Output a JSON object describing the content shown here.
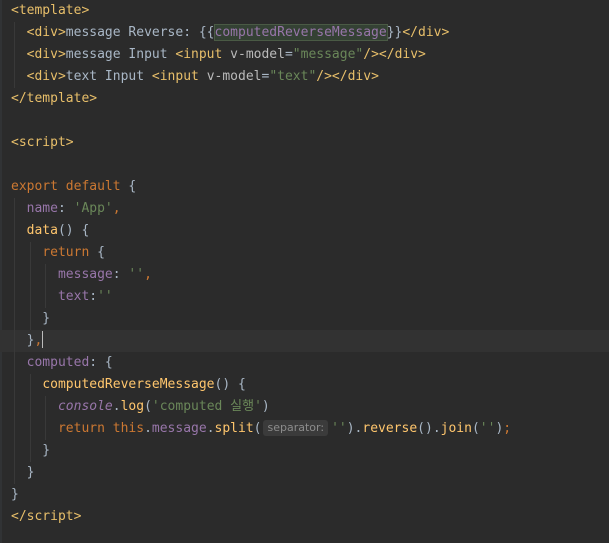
{
  "editor": {
    "language": "vue",
    "current_line": 16,
    "lines": [
      {
        "n": 1,
        "tokens": [
          [
            "tag",
            "<"
          ],
          [
            "tagname",
            "template"
          ],
          [
            "tag",
            ">"
          ]
        ]
      },
      {
        "n": 2,
        "tokens": [
          [
            "plain",
            "  "
          ],
          [
            "tag",
            "<"
          ],
          [
            "tagname",
            "div"
          ],
          [
            "tag",
            ">"
          ],
          [
            "plain",
            "message Reverse: {{"
          ],
          [
            "interpbox",
            "computedReverseMessage"
          ],
          [
            "plain",
            "}}"
          ],
          [
            "tag",
            "</"
          ],
          [
            "tagname",
            "div"
          ],
          [
            "tag",
            ">"
          ]
        ]
      },
      {
        "n": 3,
        "tokens": [
          [
            "plain",
            "  "
          ],
          [
            "tag",
            "<"
          ],
          [
            "tagname",
            "div"
          ],
          [
            "tag",
            ">"
          ],
          [
            "plain",
            "message Input "
          ],
          [
            "tag",
            "<"
          ],
          [
            "tagname",
            "input"
          ],
          [
            "plain",
            " "
          ],
          [
            "attr",
            "v-model"
          ],
          [
            "plain",
            "="
          ],
          [
            "str",
            "\"message\""
          ],
          [
            "tag",
            "/></"
          ],
          [
            "tagname",
            "div"
          ],
          [
            "tag",
            ">"
          ]
        ]
      },
      {
        "n": 4,
        "tokens": [
          [
            "plain",
            "  "
          ],
          [
            "tag",
            "<"
          ],
          [
            "tagname",
            "div"
          ],
          [
            "tag",
            ">"
          ],
          [
            "plain",
            "text Input "
          ],
          [
            "tag",
            "<"
          ],
          [
            "tagname",
            "input"
          ],
          [
            "plain",
            " "
          ],
          [
            "attr",
            "v-model"
          ],
          [
            "plain",
            "="
          ],
          [
            "str",
            "\"text\""
          ],
          [
            "tag",
            "/></"
          ],
          [
            "tagname",
            "div"
          ],
          [
            "tag",
            ">"
          ]
        ]
      },
      {
        "n": 5,
        "tokens": [
          [
            "tag",
            "</"
          ],
          [
            "tagname",
            "template"
          ],
          [
            "tag",
            ">"
          ]
        ]
      },
      {
        "n": 6,
        "tokens": []
      },
      {
        "n": 7,
        "tokens": [
          [
            "tag",
            "<"
          ],
          [
            "tagname",
            "script"
          ],
          [
            "tag",
            ">"
          ]
        ]
      },
      {
        "n": 8,
        "tokens": []
      },
      {
        "n": 9,
        "tokens": [
          [
            "kw",
            "export default"
          ],
          [
            "plain",
            " {"
          ]
        ]
      },
      {
        "n": 10,
        "tokens": [
          [
            "plain",
            "  "
          ],
          [
            "prop",
            "name"
          ],
          [
            "plain",
            ": "
          ],
          [
            "str",
            "'App'"
          ],
          [
            "kw",
            ","
          ]
        ]
      },
      {
        "n": 11,
        "tokens": [
          [
            "plain",
            "  "
          ],
          [
            "fn",
            "data"
          ],
          [
            "plain",
            "() {"
          ]
        ]
      },
      {
        "n": 12,
        "tokens": [
          [
            "plain",
            "    "
          ],
          [
            "kw",
            "return"
          ],
          [
            "plain",
            " {"
          ]
        ]
      },
      {
        "n": 13,
        "tokens": [
          [
            "plain",
            "      "
          ],
          [
            "prop",
            "message"
          ],
          [
            "plain",
            ": "
          ],
          [
            "str",
            "''"
          ],
          [
            "kw",
            ","
          ]
        ]
      },
      {
        "n": 14,
        "tokens": [
          [
            "plain",
            "      "
          ],
          [
            "prop",
            "text"
          ],
          [
            "plain",
            ":"
          ],
          [
            "str",
            "''"
          ]
        ]
      },
      {
        "n": 15,
        "tokens": [
          [
            "plain",
            "    }"
          ]
        ]
      },
      {
        "n": 16,
        "tokens": [
          [
            "plain",
            "  }"
          ],
          [
            "kw",
            ","
          ],
          [
            "caret",
            ""
          ]
        ]
      },
      {
        "n": 17,
        "tokens": [
          [
            "plain",
            "  "
          ],
          [
            "prop",
            "computed"
          ],
          [
            "plain",
            ": {"
          ]
        ]
      },
      {
        "n": 18,
        "tokens": [
          [
            "plain",
            "    "
          ],
          [
            "fn",
            "computedReverseMessage"
          ],
          [
            "plain",
            "() {"
          ]
        ]
      },
      {
        "n": 19,
        "tokens": [
          [
            "plain",
            "      "
          ],
          [
            "ital",
            "console"
          ],
          [
            "plain",
            "."
          ],
          [
            "fn",
            "log"
          ],
          [
            "plain",
            "("
          ],
          [
            "str",
            "'computed 실행'"
          ],
          [
            "plain",
            ")"
          ]
        ]
      },
      {
        "n": 20,
        "tokens": [
          [
            "plain",
            "      "
          ],
          [
            "kw",
            "return this"
          ],
          [
            "plain",
            "."
          ],
          [
            "prop",
            "message"
          ],
          [
            "plain",
            "."
          ],
          [
            "fn",
            "split"
          ],
          [
            "plain",
            "("
          ],
          [
            "hint",
            "separator:"
          ],
          [
            "str",
            "''"
          ],
          [
            "plain",
            ")."
          ],
          [
            "fn",
            "reverse"
          ],
          [
            "plain",
            "()."
          ],
          [
            "fn",
            "join"
          ],
          [
            "plain",
            "("
          ],
          [
            "str",
            "''"
          ],
          [
            "plain",
            ")"
          ],
          [
            "kw",
            ";"
          ]
        ]
      },
      {
        "n": 21,
        "tokens": [
          [
            "plain",
            "    }"
          ]
        ]
      },
      {
        "n": 22,
        "tokens": [
          [
            "plain",
            "  }"
          ]
        ]
      },
      {
        "n": 23,
        "tokens": [
          [
            "plain",
            "}"
          ]
        ]
      },
      {
        "n": 24,
        "tokens": [
          [
            "tag",
            "</"
          ],
          [
            "tagname",
            "script"
          ],
          [
            "tag",
            ">"
          ]
        ]
      }
    ]
  }
}
